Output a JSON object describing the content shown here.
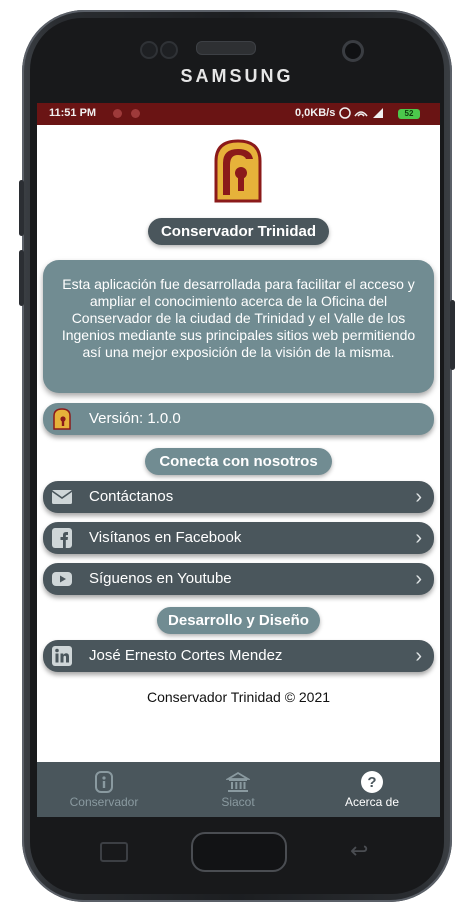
{
  "device": {
    "brand": "SAMSUNG"
  },
  "statusbar": {
    "time": "11:51 PM",
    "speed": "0,0KB/s",
    "battery": "52"
  },
  "app": {
    "title": "Conservador Trinidad",
    "description": "Esta aplicación fue desarrollada para facilitar el acceso y ampliar el conocimiento acerca de la Oficina del Conservador de la ciudad de Trinidad y el Valle de los Ingenios mediante sus principales sitios web permitiendo así una mejor exposición de la visión de la misma.",
    "version_label": "Versión: 1.0.0",
    "contact_header": "Conecta con nosotros",
    "contact_items": [
      {
        "label": "Contáctanos",
        "icon": "mail-icon"
      },
      {
        "label": "Visítanos en Facebook",
        "icon": "facebook-icon"
      },
      {
        "label": "Síguenos en Youtube",
        "icon": "youtube-icon"
      }
    ],
    "dev_header": "Desarrollo y Diseño",
    "developer": {
      "label": "José Ernesto Cortes Mendez",
      "icon": "linkedin-icon"
    },
    "footer": "Conservador Trinidad © 2021"
  },
  "nav": [
    {
      "label": "Conservador",
      "icon": "info-icon",
      "active": false
    },
    {
      "label": "Siacot",
      "icon": "building-icon",
      "active": false
    },
    {
      "label": "Acerca de",
      "icon": "help-icon",
      "active": true
    }
  ],
  "colors": {
    "accent_dark": "#4a565c",
    "accent_light": "#718c92",
    "statusbar": "#6a1414",
    "logo_gold": "#e6b23a",
    "logo_red": "#8b1a1a"
  }
}
